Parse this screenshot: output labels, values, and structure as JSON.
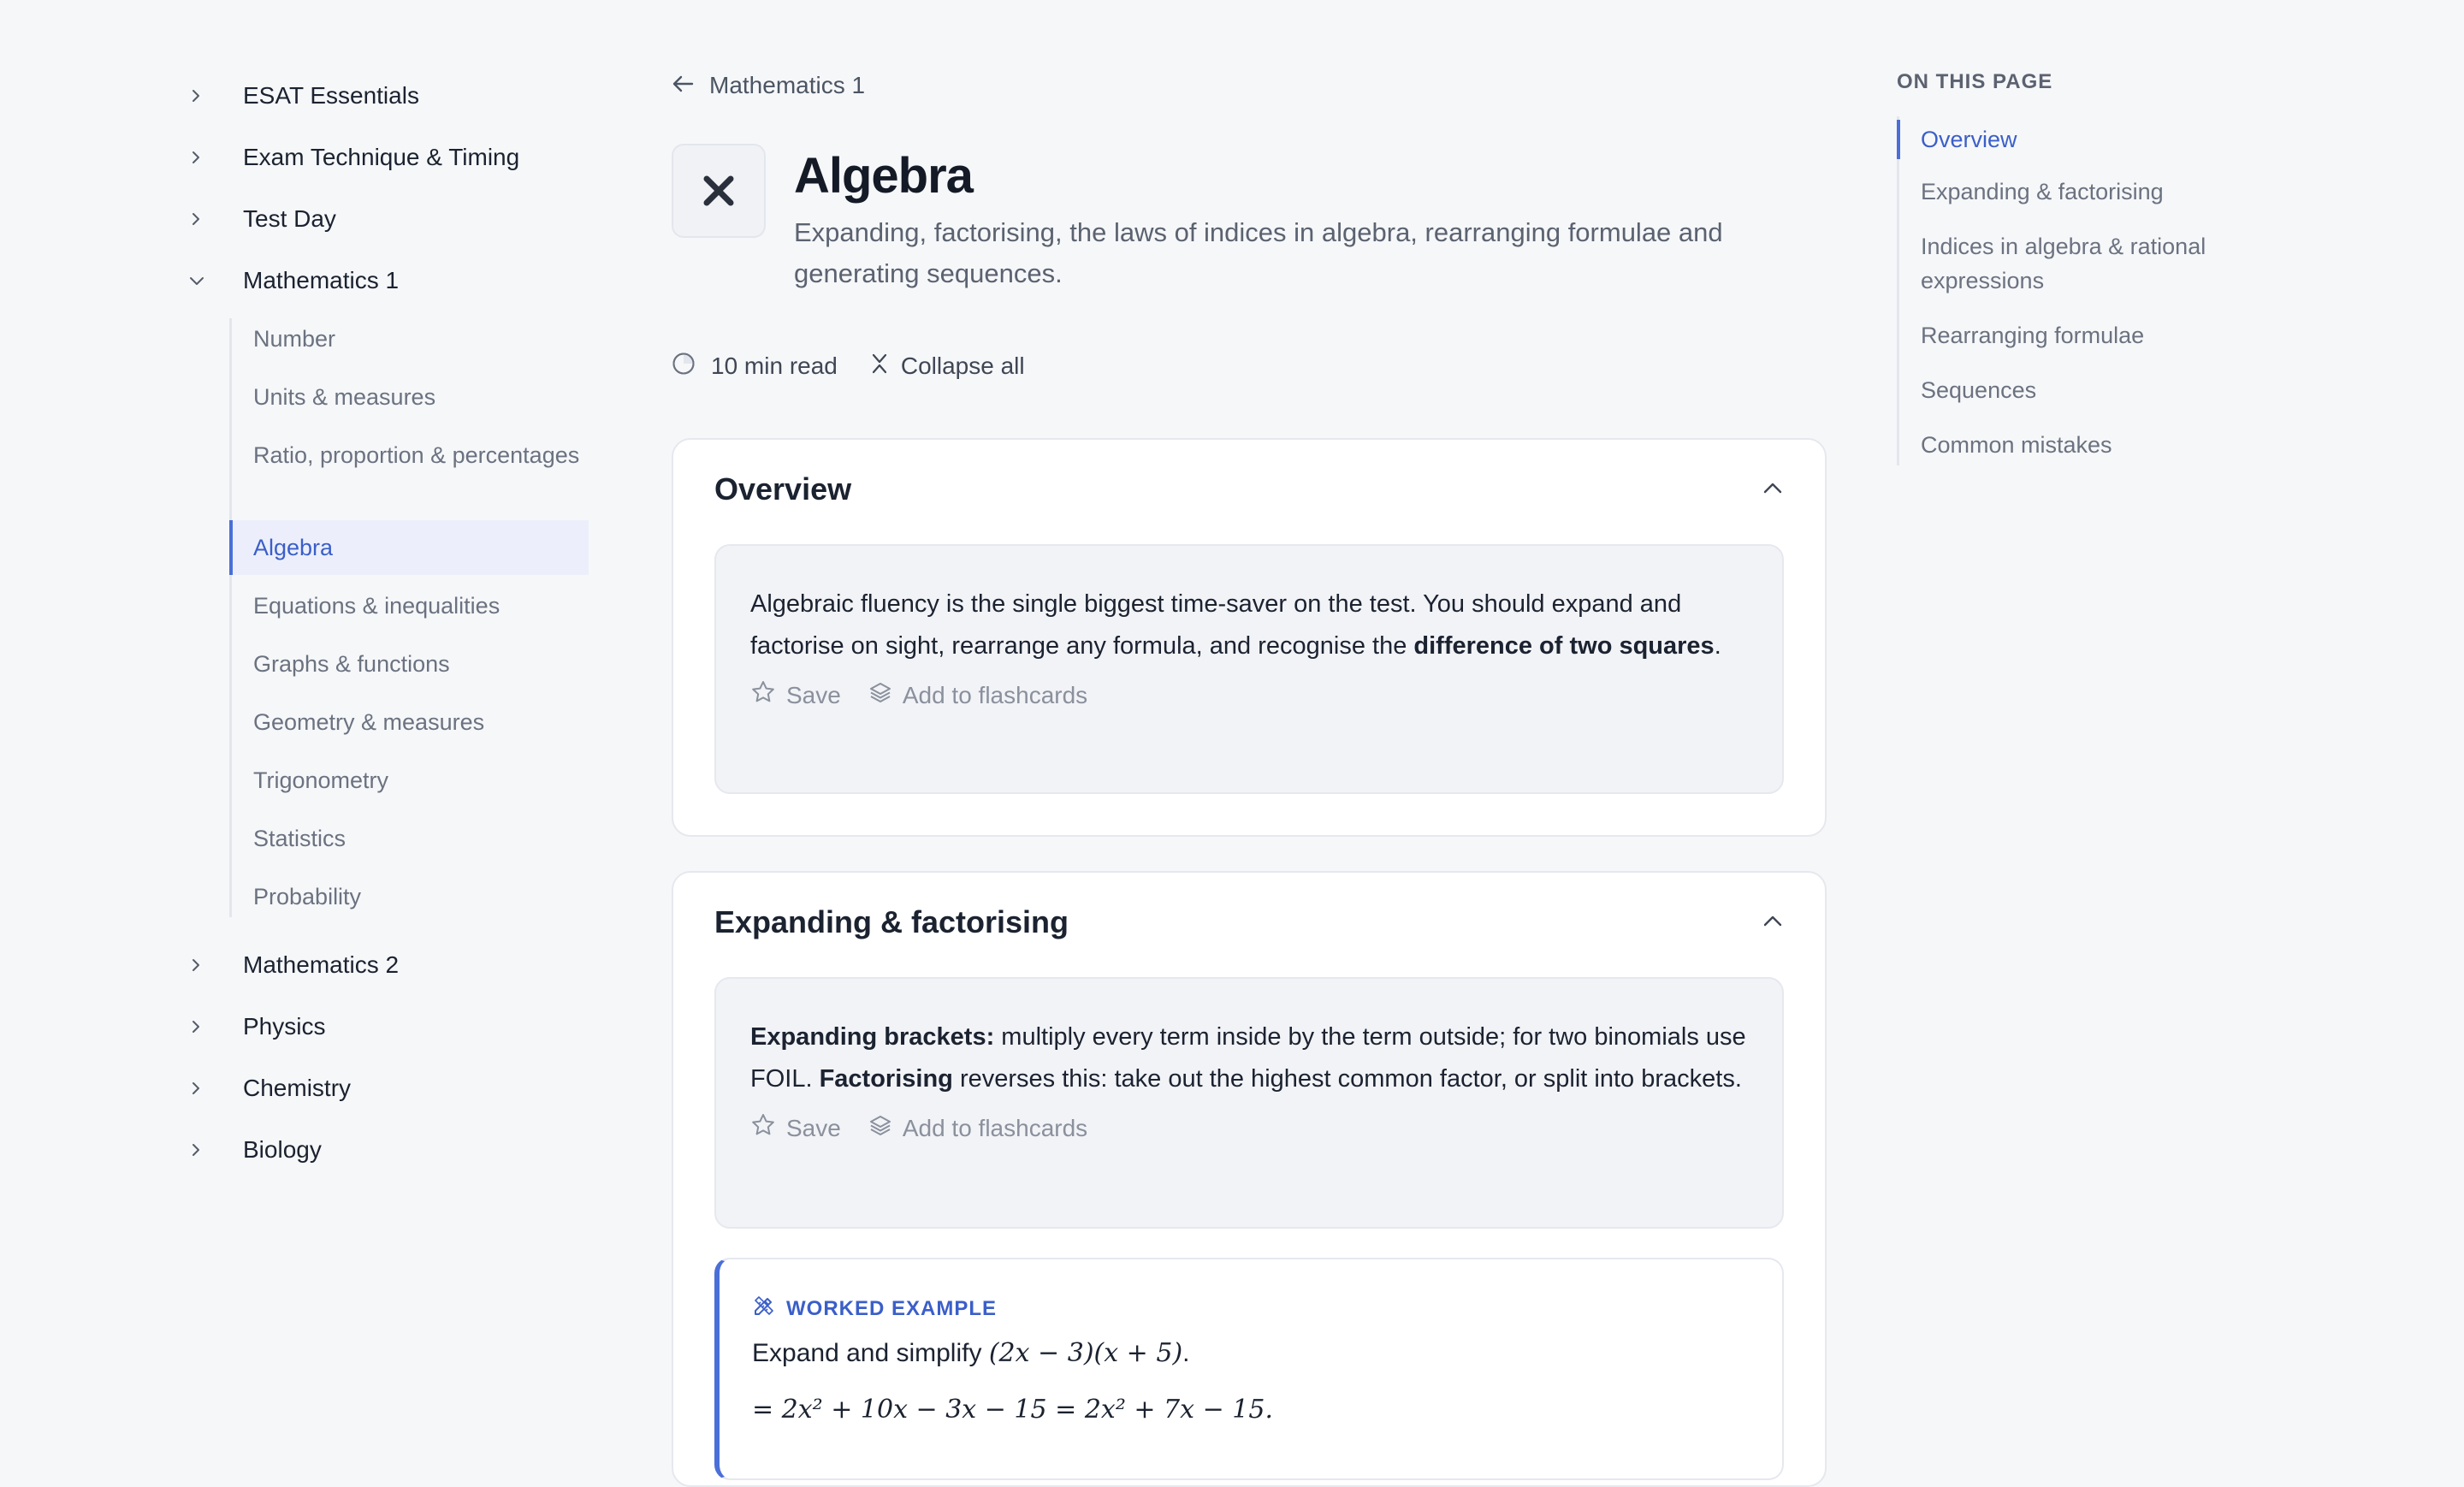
{
  "sidebar": {
    "sections_top": [
      {
        "label": "ESAT Essentials",
        "icon": "chevron-right-icon"
      },
      {
        "label": "Exam Technique & Timing",
        "icon": "chevron-right-icon"
      },
      {
        "label": "Test Day",
        "icon": "chevron-right-icon"
      }
    ],
    "expanded": {
      "label": "Mathematics 1",
      "icon": "chevron-down-icon"
    },
    "sub_items": [
      {
        "label": "Number"
      },
      {
        "label": "Units & measures"
      },
      {
        "label": "Ratio, proportion & percentages"
      },
      {
        "label": "Algebra",
        "active": true
      },
      {
        "label": "Equations & inequalities"
      },
      {
        "label": "Graphs & functions"
      },
      {
        "label": "Geometry & measures"
      },
      {
        "label": "Trigonometry"
      },
      {
        "label": "Statistics"
      },
      {
        "label": "Probability"
      }
    ],
    "sections_bottom": [
      {
        "label": "Mathematics 2",
        "icon": "chevron-right-icon"
      },
      {
        "label": "Physics",
        "icon": "chevron-right-icon"
      },
      {
        "label": "Chemistry",
        "icon": "chevron-right-icon"
      },
      {
        "label": "Biology",
        "icon": "chevron-right-icon"
      }
    ]
  },
  "main": {
    "back_label": "Mathematics 1",
    "page_icon": "multiply-icon",
    "title": "Algebra",
    "subtitle": "Expanding, factorising, the laws of indices in algebra, rearranging formulae and generating sequences.",
    "read_time": "10 min read",
    "collapse_label": "Collapse all",
    "sections": [
      {
        "title": "Overview",
        "text_parts": [
          "Algebraic fluency is the single biggest time-saver on the test. You should expand and factorise on sight, rearrange any formula, and recognise the ",
          "difference of two squares",
          "."
        ]
      },
      {
        "title": "Expanding & factorising",
        "text_parts": [
          "Expanding brackets:",
          " multiply every term inside by the term outside; for two binomials use FOIL. ",
          "Factorising",
          " reverses this: take out the highest common factor, or split into brackets."
        ],
        "worked_example": {
          "tag": "WORKED EXAMPLE",
          "question_text": "Expand and simplify ",
          "question_math": "(2x − 3)(x + 5)",
          "question_end": ".",
          "answer_math": "= 2x² + 10x − 3x − 15 = 2x² + 7x − 15."
        }
      }
    ],
    "actions": {
      "save": "Save",
      "flashcards": "Add to flashcards"
    }
  },
  "toc": {
    "heading": "ON THIS PAGE",
    "items": [
      {
        "label": "Overview",
        "active": true
      },
      {
        "label": "Expanding & factorising"
      },
      {
        "label": "Indices in algebra & rational expressions"
      },
      {
        "label": "Rearranging formulae"
      },
      {
        "label": "Sequences"
      },
      {
        "label": "Common mistakes"
      }
    ]
  },
  "colors": {
    "accent": "#3b5fc9",
    "background": "#f6f7f9",
    "card": "#ffffff",
    "callout": "#f2f3f7"
  }
}
